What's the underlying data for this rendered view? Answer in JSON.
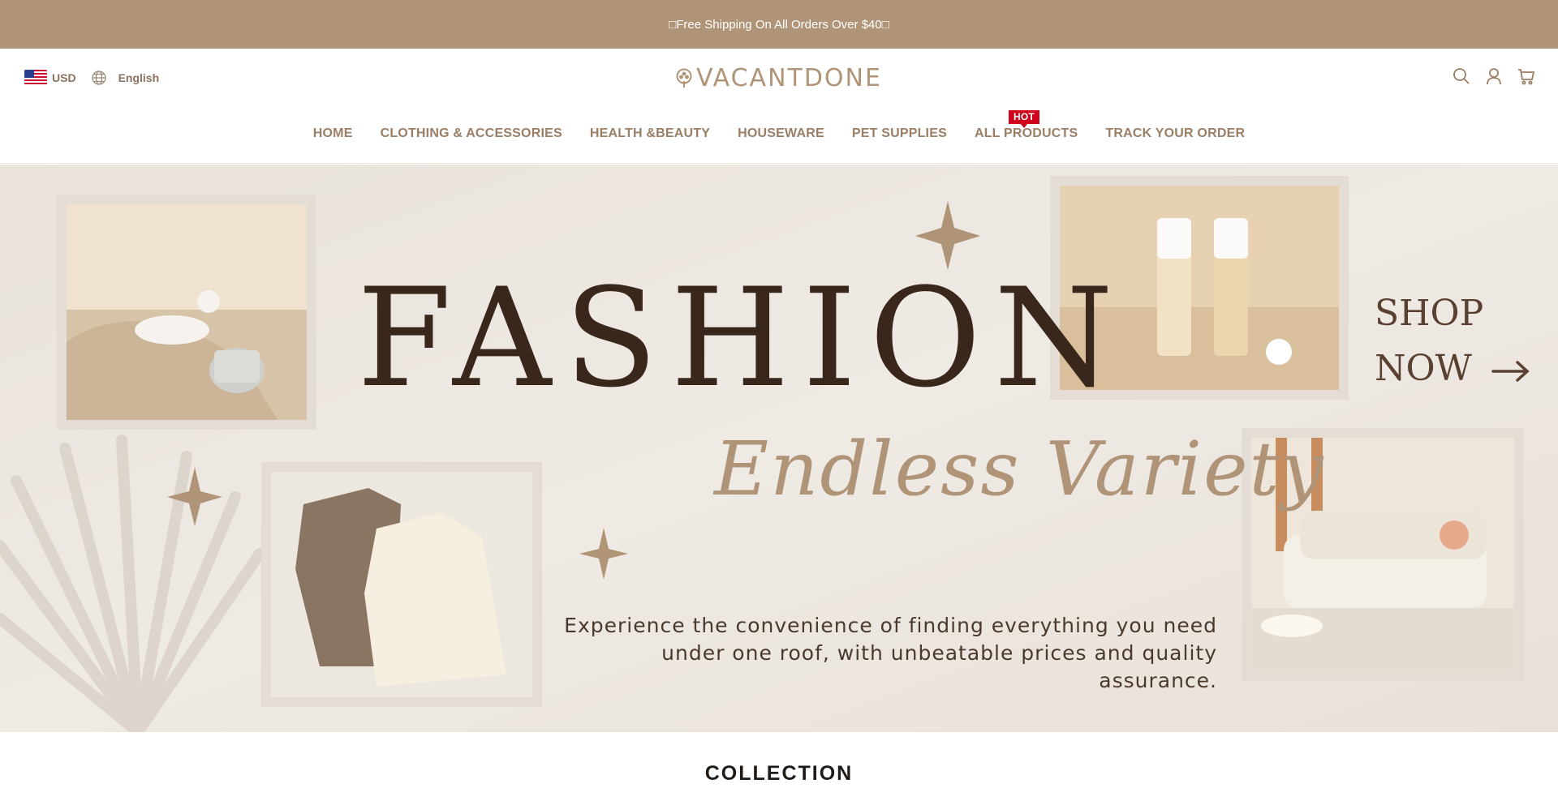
{
  "announcement": {
    "text": "□Free Shipping On All Orders Over $40□"
  },
  "locale": {
    "currency": "USD",
    "language": "English",
    "flag_icon": "us-flag-icon",
    "language_icon": "globe-icon"
  },
  "brand": {
    "name": "VACANTDONE",
    "color": "#b09478"
  },
  "header_actions": {
    "search_icon": "search-icon",
    "account_icon": "user-icon",
    "cart_icon": "cart-icon"
  },
  "nav": {
    "items": [
      {
        "label": "HOME"
      },
      {
        "label": "CLOTHING & ACCESSORIES"
      },
      {
        "label": "HEALTH &BEAUTY"
      },
      {
        "label": "HOUSEWARE"
      },
      {
        "label": "PET SUPPLIES"
      },
      {
        "label": "ALL PRODUCTS",
        "badge": "HOT"
      },
      {
        "label": "TRACK YOUR ORDER"
      }
    ]
  },
  "hero": {
    "headline": "FASHION",
    "tagline": "Endless Variety",
    "cta_line1": "SHOP",
    "cta_line2": "NOW",
    "body_line1": "Experience the convenience of finding everything you need",
    "body_line2": "under one roof, with unbeatable prices and quality assurance.",
    "accent_color": "#b09478",
    "headline_color": "#3a271b"
  },
  "sections": {
    "collection_title": "COLLECTION"
  }
}
